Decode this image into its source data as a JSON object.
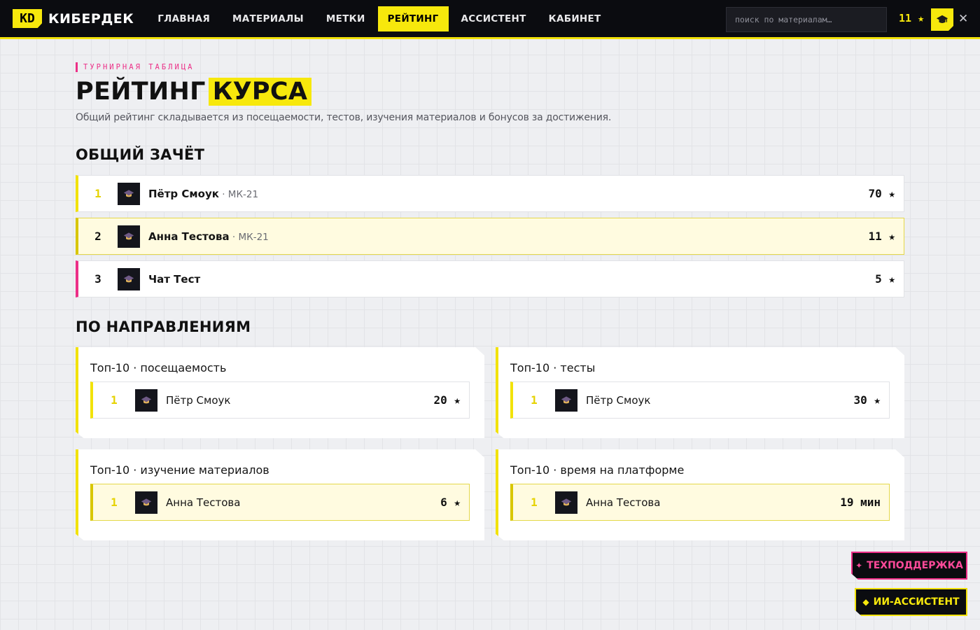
{
  "brand": {
    "badge": "KD",
    "name": "КИБЕРДЕК"
  },
  "nav": {
    "items": [
      {
        "label": "ГЛАВНАЯ"
      },
      {
        "label": "МАТЕРИАЛЫ"
      },
      {
        "label": "МЕТКИ"
      },
      {
        "label": "РЕЙТИНГ",
        "active": true
      },
      {
        "label": "АССИСТЕНТ"
      },
      {
        "label": "КАБИНЕТ"
      }
    ]
  },
  "search": {
    "placeholder": "поиск по материалам…"
  },
  "user": {
    "stars": "11 ★",
    "icon": "graduation-cap-icon"
  },
  "header": {
    "eyebrow": "ТУРНИРНАЯ ТАБЛИЦА",
    "title_main": "РЕЙТИНГ",
    "title_highlight": "КУРСА",
    "subtitle": "Общий рейтинг складывается из посещаемости, тестов, изучения материалов и бонусов за достижения."
  },
  "overall": {
    "title": "ОБЩИЙ ЗАЧЁТ",
    "rows": [
      {
        "rank": "1",
        "name": "Пётр Смоук",
        "group": " · МК-21",
        "score": "70 ★"
      },
      {
        "rank": "2",
        "name": "Анна Тестова",
        "group": " · МК-21",
        "score": "11 ★"
      },
      {
        "rank": "3",
        "name": "Чат Тест",
        "group": "",
        "score": "5 ★"
      }
    ]
  },
  "categories": {
    "title": "ПО НАПРАВЛЕНИЯМ",
    "cards": [
      {
        "title": "Топ-10 · посещаемость",
        "rank": "1",
        "name": "Пётр Смоук",
        "score": "20 ★"
      },
      {
        "title": "Топ-10 · тесты",
        "rank": "1",
        "name": "Пётр Смоук",
        "score": "30 ★"
      },
      {
        "title": "Топ-10 · изучение материалов",
        "rank": "1",
        "name": "Анна Тестова",
        "score": "6 ★"
      },
      {
        "title": "Топ-10 · время на платформе",
        "rank": "1",
        "name": "Анна Тестова",
        "score": "19 мин"
      }
    ]
  },
  "floating": {
    "support": {
      "glyph": "✦",
      "label": "ТЕХПОДДЕРЖКА"
    },
    "assistant": {
      "glyph": "◆",
      "label": "ИИ-АССИСТЕНТ"
    }
  },
  "colors": {
    "accent": "#f7e80c",
    "pink": "#ec2f87",
    "dark": "#0b0c10"
  }
}
